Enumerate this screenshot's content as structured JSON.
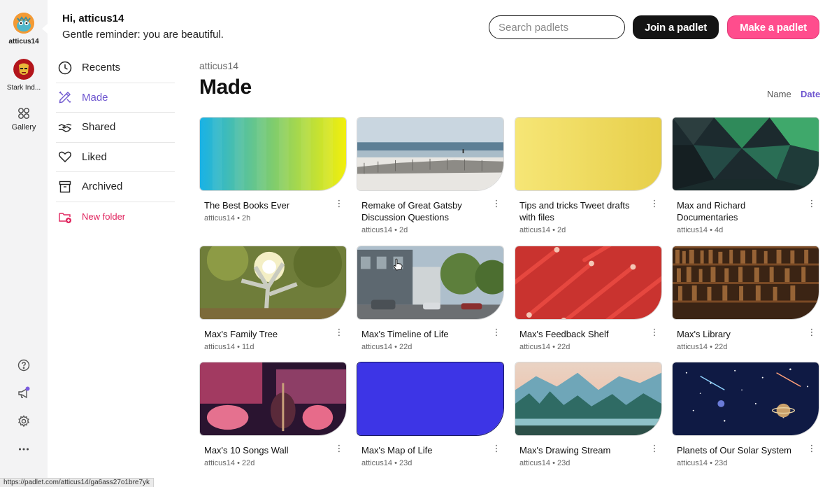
{
  "rail": {
    "user_label": "atticus14",
    "workspace_label": "Stark Ind...",
    "gallery_label": "Gallery"
  },
  "header": {
    "greeting": "Hi, atticus14",
    "reminder": "Gentle reminder: you are beautiful.",
    "search_placeholder": "Search padlets",
    "join_label": "Join a padlet",
    "make_label": "Make a padlet"
  },
  "nav": {
    "items": [
      {
        "label": "Recents",
        "icon": "clock-icon"
      },
      {
        "label": "Made",
        "icon": "pencil-ruler-icon"
      },
      {
        "label": "Shared",
        "icon": "handshake-icon"
      },
      {
        "label": "Liked",
        "icon": "heart-icon"
      },
      {
        "label": "Archived",
        "icon": "archive-box-icon"
      }
    ],
    "new_folder": "New folder"
  },
  "content": {
    "breadcrumb": "atticus14",
    "title": "Made",
    "sort_name": "Name",
    "sort_date": "Date"
  },
  "padlets": [
    {
      "title": "The Best Books Ever",
      "meta": "atticus14 • 2h"
    },
    {
      "title": "Remake of Great Gatsby Discussion Questions",
      "meta": "atticus14 • 2d"
    },
    {
      "title": "Tips and tricks Tweet drafts with files",
      "meta": "atticus14 • 2d"
    },
    {
      "title": "Max and Richard Documentaries",
      "meta": "atticus14 • 4d"
    },
    {
      "title": "Max's Family Tree",
      "meta": "atticus14 • 11d"
    },
    {
      "title": "Max's Timeline of Life",
      "meta": "atticus14 • 22d"
    },
    {
      "title": "Max's Feedback Shelf",
      "meta": "atticus14 • 22d"
    },
    {
      "title": "Max's Library",
      "meta": "atticus14 • 22d"
    },
    {
      "title": "Max's 10 Songs Wall",
      "meta": "atticus14 • 22d"
    },
    {
      "title": "Max's Map of Life",
      "meta": "atticus14 • 23d"
    },
    {
      "title": "Max's Drawing Stream",
      "meta": "atticus14 • 23d"
    },
    {
      "title": "Planets of Our Solar System",
      "meta": "atticus14 • 23d"
    }
  ],
  "status_url": "https://padlet.com/atticus14/ga6ass27o1bre7yk",
  "colors": {
    "accent_purple": "#6e56cf",
    "make_pink": "#ff4d8d",
    "new_folder_red": "#e0245e",
    "map_blue": "#3d35e6",
    "tips_yellow": "#f2e06a"
  }
}
